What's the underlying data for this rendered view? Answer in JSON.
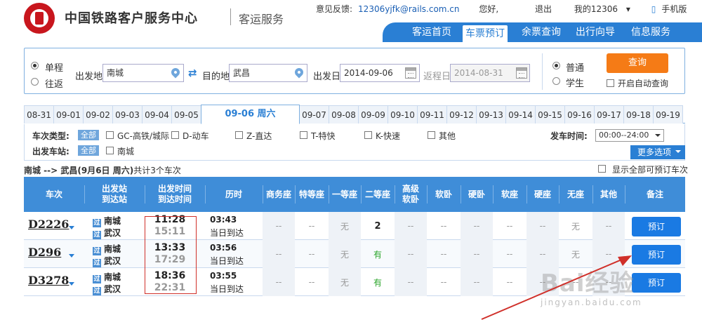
{
  "header": {
    "site_title": "中国铁路客户服务中心",
    "site_sub": "客运服务",
    "feedback_label": "意见反馈:",
    "feedback_email": "12306yjfk@rails.com.cn",
    "greeting": "您好,",
    "logout": "退出",
    "my12306": "我的12306",
    "mobile": "手机版",
    "nav": [
      "客运首页",
      "车票预订",
      "余票查询",
      "出行向导",
      "信息服务"
    ],
    "nav_active": "车票预订"
  },
  "search": {
    "trip_oneway": "单程",
    "trip_return": "往返",
    "from_label": "出发地",
    "from_value": "南城",
    "to_label": "目的地",
    "to_value": "武昌",
    "depart_label": "出发日",
    "depart_value": "2014-09-06",
    "return_label": "返程日",
    "return_value": "2014-08-31",
    "type_normal": "普通",
    "type_student": "学生",
    "search_button": "查询",
    "auto_query": "开启自动查询"
  },
  "dates": [
    "08-31",
    "09-01",
    "09-02",
    "09-03",
    "09-04",
    "09-05",
    "09-06 周六",
    "09-07",
    "09-08",
    "09-09",
    "09-10",
    "09-11",
    "09-12",
    "09-13",
    "09-14",
    "09-15",
    "09-16",
    "09-17",
    "09-18",
    "09-19"
  ],
  "filters": {
    "type_label": "车次类型:",
    "all": "全部",
    "types": [
      "GC-高铁/城际",
      "D-动车",
      "Z-直达",
      "T-特快",
      "K-快速",
      "其他"
    ],
    "depart_time_label": "发车时间:",
    "depart_time_value": "00:00--24:00",
    "station_label": "出发车站:",
    "stations": [
      "南城"
    ],
    "more_options": "更多选项"
  },
  "summary": {
    "route": "南城 --> 武昌",
    "date": "(9月6日  周六)",
    "count_text": "共计3个车次",
    "show_all": "显示全部可预订车次"
  },
  "table": {
    "headers": [
      "车次",
      "出发站\n到达站",
      "出发时间\n到达时间",
      "历时",
      "商务座",
      "特等座",
      "一等座",
      "二等座",
      "高级\n软卧",
      "软卧",
      "硬卧",
      "软座",
      "硬座",
      "无座",
      "其他",
      "备注"
    ],
    "rows": [
      {
        "train": "D2226",
        "from": "南城",
        "to": "武汉",
        "dep": "11:28",
        "arr": "15:11",
        "dur": "03:43",
        "day": "当日到达",
        "seats": [
          "--",
          "--",
          "无",
          "2",
          "--",
          "--",
          "--",
          "--",
          "--",
          "无",
          "--"
        ],
        "book": "预订"
      },
      {
        "train": "D296",
        "from": "南城",
        "to": "武汉",
        "dep": "13:33",
        "arr": "17:29",
        "dur": "03:56",
        "day": "当日到达",
        "seats": [
          "--",
          "--",
          "无",
          "有",
          "--",
          "--",
          "--",
          "--",
          "--",
          "无",
          "--"
        ],
        "book": "预订"
      },
      {
        "train": "D3278",
        "from": "南城",
        "to": "武汉",
        "dep": "18:36",
        "arr": "22:31",
        "dur": "03:55",
        "day": "当日到达",
        "seats": [
          "--",
          "--",
          "无",
          "有",
          "--",
          "--",
          "--",
          "--",
          "--",
          "--",
          "--"
        ],
        "book": "预订"
      }
    ]
  },
  "watermark": {
    "main": "Bai经验",
    "sub": "jingyan.baidu.com"
  },
  "colors": {
    "brand_blue": "#2a7fd4",
    "search_orange": "#f57b16",
    "logo_red": "#c8161d",
    "highlight_red": "#d0302a"
  }
}
